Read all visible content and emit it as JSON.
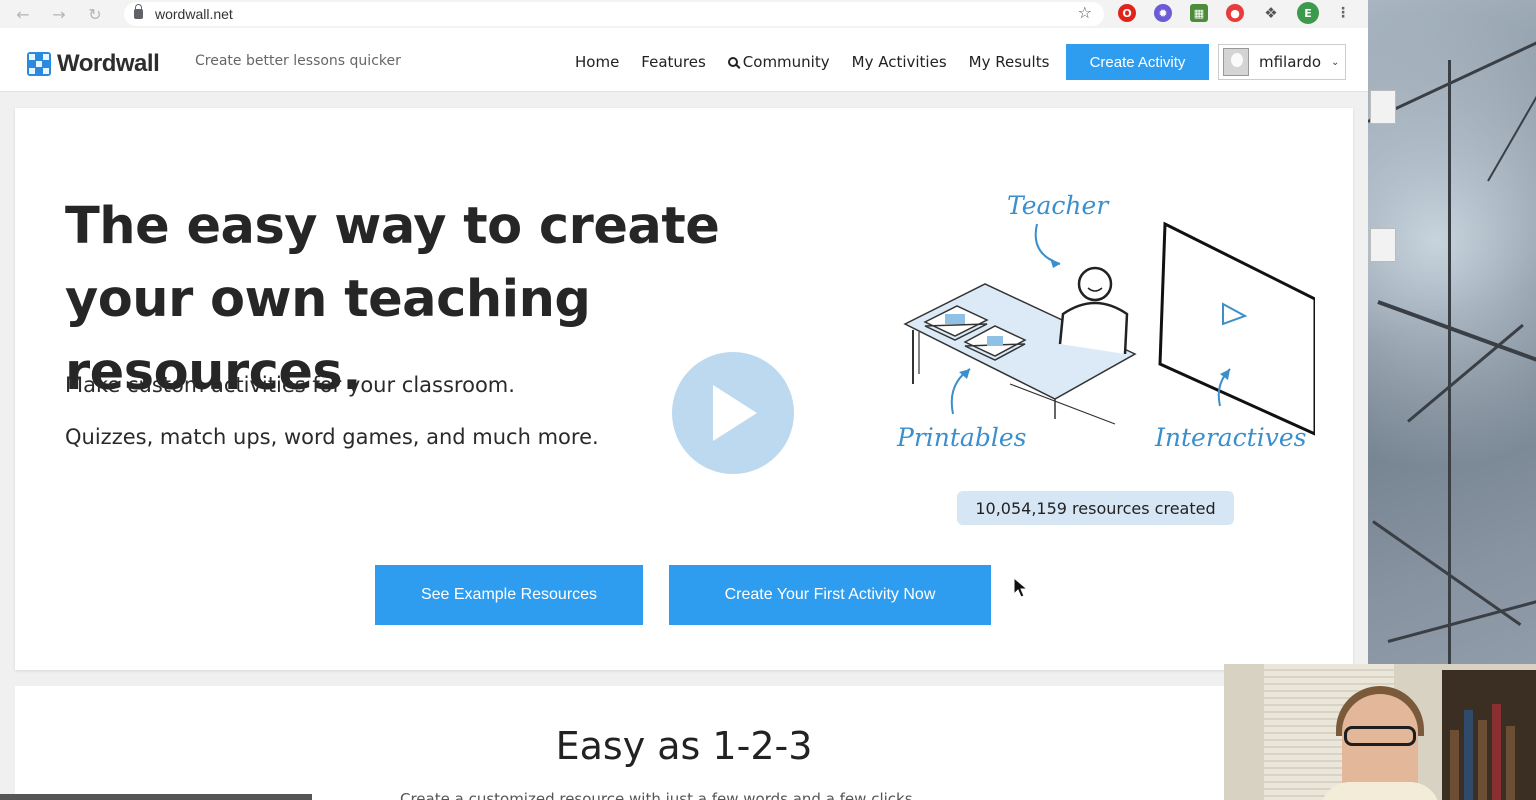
{
  "browser": {
    "url": "wordwall.net",
    "avatar_letter": "E"
  },
  "site": {
    "brand": "Wordwall",
    "tagline": "Create better lessons quicker",
    "nav": {
      "home": "Home",
      "features": "Features",
      "community": "Community",
      "my_activities": "My Activities",
      "my_results": "My Results"
    },
    "create_activity": "Create Activity",
    "username": "mfilardo"
  },
  "hero": {
    "headline": "The easy way to create your own teaching resources.",
    "subline1": "Make custom activities for your classroom.",
    "subline2": "Quizzes, match ups, word games, and much more.",
    "illustration": {
      "teacher": "Teacher",
      "printables": "Printables",
      "interactives": "Interactives"
    },
    "counter": "10,054,159 resources created",
    "cta_examples": "See Example Resources",
    "cta_create": "Create Your First Activity Now"
  },
  "easy": {
    "title": "Easy as 1-2-3",
    "subtitle": "Create a customized resource with just a few words and a few clicks."
  },
  "colors": {
    "accent": "#2e9df0",
    "illustration": "#3a8fcc"
  }
}
